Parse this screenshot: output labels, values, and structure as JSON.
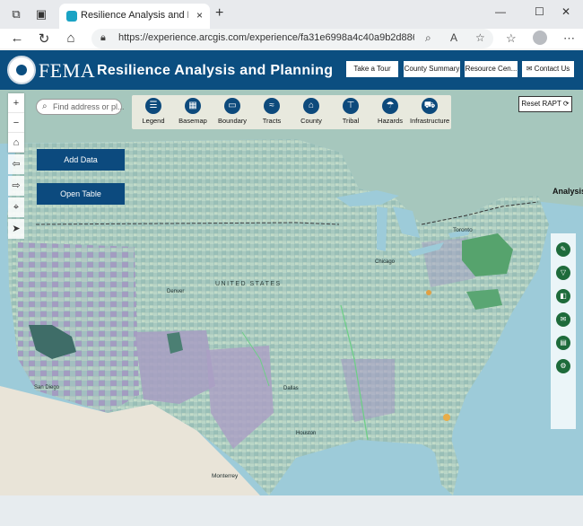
{
  "browser": {
    "tab_title": "Resilience Analysis and Planning",
    "tab_close": "×",
    "new_tab": "+",
    "url": "https://experience.arcgis.com/experience/fa31e6998a4c40a9b2d8861d8...",
    "icons": [
      "tab-actions-icon",
      "tab-switcher-icon",
      "back-icon",
      "refresh-icon",
      "home-icon",
      "lock-icon",
      "zoom-icon",
      "read-aloud-icon",
      "favorite-icon",
      "collections-icon",
      "profile-icon",
      "more-icon"
    ]
  },
  "header": {
    "agency": "FEMA",
    "title": "Resilience Analysis and Planning",
    "buttons": {
      "tour": "Take a Tour",
      "county_summary": "County Summary",
      "resource_center": "Resource Cen...",
      "contact": "Contact Us"
    }
  },
  "map": {
    "search_placeholder": "Find address or pl...",
    "zoom_in": "+",
    "zoom_out": "−",
    "toolbar": {
      "legend": "Legend",
      "basemap": "Basemap",
      "boundary": "Boundary",
      "tracts": "Tracts",
      "county": "County",
      "tribal": "Tribal",
      "hazards": "Hazards",
      "infrastructure": "Infrastructure"
    },
    "reset": "Reset RAPT",
    "add_data": "Add Data",
    "open_table": "Open Table",
    "analysis": "Analysis",
    "labels": {
      "united_states": "UNITED STATES",
      "toronto": "Toronto",
      "monterrey": "Monterrey",
      "san_diego": "San Diego",
      "dallas": "Dallas",
      "houston": "Houston",
      "chicago": "Chicago",
      "denver": "Denver"
    },
    "colors": {
      "water": "#9dcbd9",
      "land_base": "#a9c8c0",
      "purple": "#9a8fba",
      "green": "#56a36d",
      "mexico": "#e9e4d8"
    }
  }
}
